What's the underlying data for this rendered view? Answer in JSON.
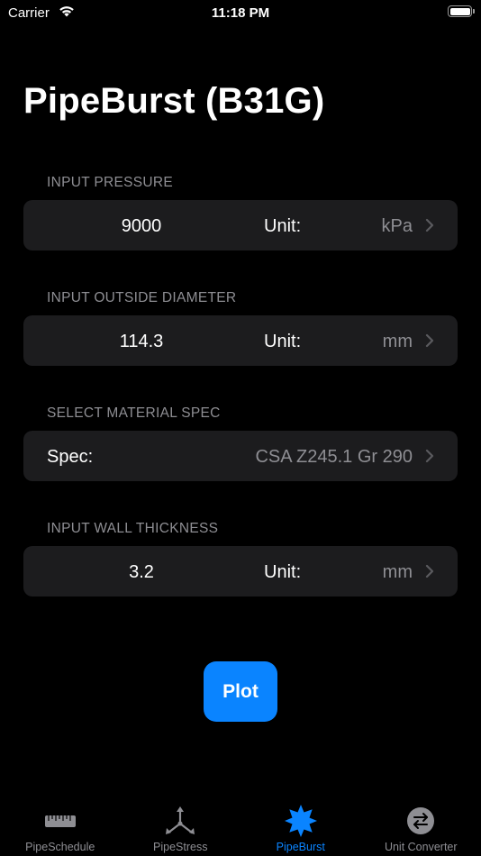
{
  "status_bar": {
    "carrier": "Carrier",
    "time": "11:18 PM"
  },
  "page": {
    "title": "PipeBurst (B31G)"
  },
  "sections": {
    "pressure": {
      "header": "INPUT PRESSURE",
      "value": "9000",
      "unit_label": "Unit:",
      "unit_value": "kPa"
    },
    "diameter": {
      "header": "INPUT OUTSIDE DIAMETER",
      "value": "114.3",
      "unit_label": "Unit:",
      "unit_value": "mm"
    },
    "material": {
      "header": "SELECT MATERIAL SPEC",
      "spec_label": "Spec:",
      "spec_value": "CSA Z245.1 Gr 290"
    },
    "wall": {
      "header": "INPUT WALL THICKNESS",
      "value": "3.2",
      "unit_label": "Unit:",
      "unit_value": "mm"
    }
  },
  "plot_button": {
    "label": "Plot"
  },
  "tab_bar": {
    "tabs": [
      {
        "label": "PipeSchedule",
        "icon": "ruler-icon",
        "active": false
      },
      {
        "label": "PipeStress",
        "icon": "tri-axis-icon",
        "active": false
      },
      {
        "label": "PipeBurst",
        "icon": "burst-star-icon",
        "active": true
      },
      {
        "label": "Unit Converter",
        "icon": "convert-arrows-icon",
        "active": false
      }
    ]
  },
  "colors": {
    "background": "#000000",
    "cell": "#1c1c1e",
    "secondary_text": "#8e8e93",
    "accent": "#0a84ff",
    "inactive_icon": "#8e8e93"
  }
}
